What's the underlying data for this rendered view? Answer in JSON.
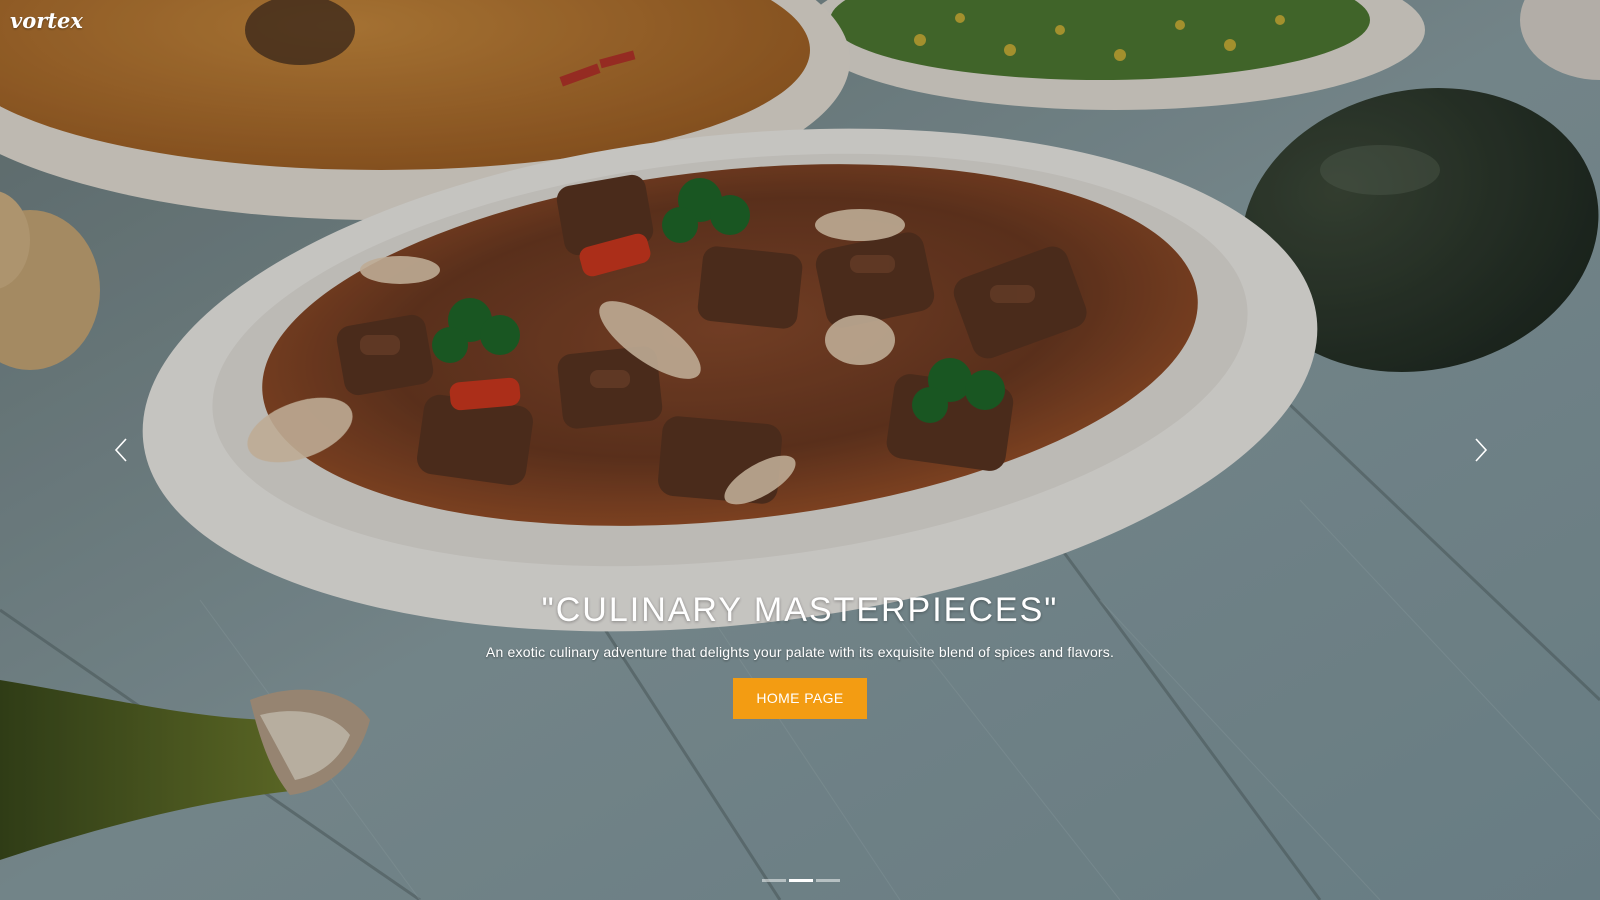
{
  "site": {
    "logo_text": "vortex"
  },
  "slide": {
    "title": "\"CULINARY MASTERPIECES\"",
    "subtitle": "An exotic culinary adventure that delights your palate with its exquisite blend of spices and flavors.",
    "button_label": "HOME PAGE"
  },
  "carousel": {
    "prev_icon": "chevron-left-icon",
    "next_icon": "chevron-right-icon",
    "slide_count": 3,
    "active_index": 1
  },
  "colors": {
    "accent": "#f39c12",
    "text": "#ffffff",
    "table_wood": "#8fa6ab"
  }
}
